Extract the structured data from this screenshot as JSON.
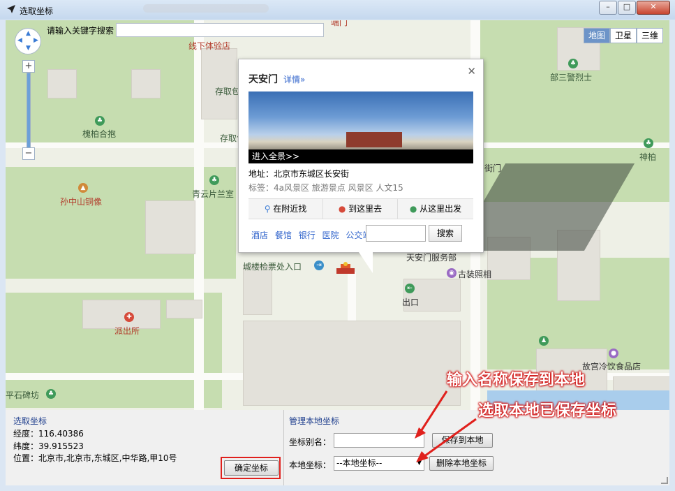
{
  "window": {
    "title": "选取坐标",
    "buttons": {
      "minimize": "–",
      "maximize": "□",
      "close": "✕"
    }
  },
  "map": {
    "search": {
      "label": "请输入关键字搜索",
      "value": ""
    },
    "map_types": [
      {
        "label": "地图",
        "active": true
      },
      {
        "label": "卫星",
        "active": false
      },
      {
        "label": "三维",
        "active": false
      }
    ],
    "zoom": {
      "plus": "+",
      "minus": "−"
    },
    "labels": {
      "l1": "线下体验店",
      "l2": "存取包",
      "l3": "存取包",
      "l4": "槐柏合抱",
      "l5": "孙中山铜像",
      "l6": "青云片兰室",
      "l7": "派出所",
      "l8": "平石碑坊",
      "l9": "部三警烈士",
      "l10": "神柏",
      "l11": "城楼检票处入口",
      "l12": "天安门服务部",
      "l13": "古装照相",
      "l14": "出口",
      "l15": "故宫冷饮食品店",
      "l16": "端门",
      "l17": "街门"
    },
    "popup": {
      "title": "天安门",
      "detail": "详情»",
      "close": "✕",
      "panorama": "进入全景>>",
      "address": "地址：北京市东城区长安街",
      "tags": "标签：4a风景区 旅游景点 风景区 人文15",
      "tabs": [
        "在附近找",
        "到这里去",
        "从这里出发"
      ],
      "links": [
        "酒店",
        "餐馆",
        "银行",
        "医院",
        "公交站"
      ],
      "search_value": "",
      "search_button": "搜索"
    }
  },
  "selected": {
    "title": "选取坐标",
    "longitude_label": "经度：",
    "longitude": "116.40386",
    "latitude_label": "纬度：",
    "latitude": "39.915523",
    "location_label": "位置：",
    "location": "北京市,北京市,东城区,中华路,甲10号",
    "confirm_button": "确定坐标"
  },
  "manage": {
    "title": "管理本地坐标",
    "alias_label": "坐标别名：",
    "alias_value": "",
    "save_button": "保存到本地",
    "local_label": "本地坐标：",
    "local_selected": "--本地坐标--",
    "delete_button": "删除本地坐标"
  },
  "annotations": {
    "a1": "输入名称保存到本地",
    "a2": "选取本地已保存坐标"
  },
  "colors": {
    "annotation": "#e0201c",
    "active_maptype": "#6d94c8"
  }
}
